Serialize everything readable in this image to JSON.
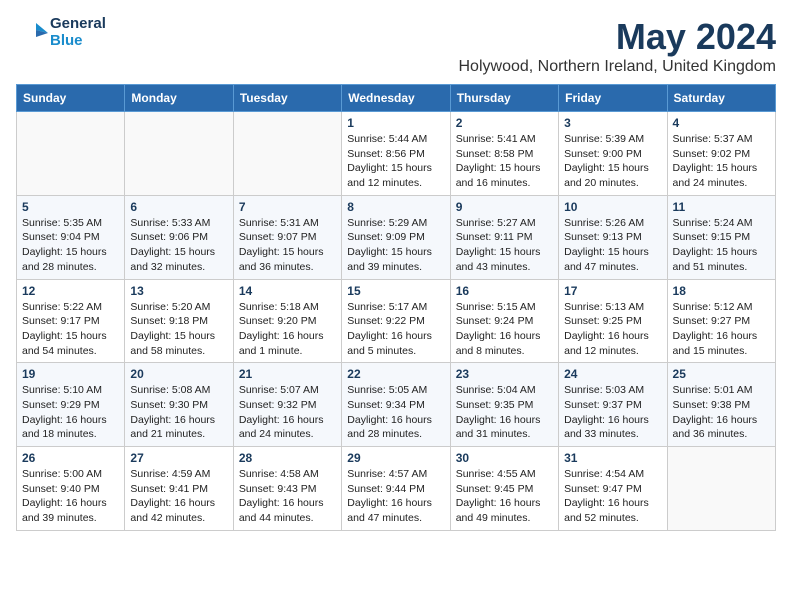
{
  "logo": {
    "line1": "General",
    "line2": "Blue"
  },
  "title": "May 2024",
  "location": "Holywood, Northern Ireland, United Kingdom",
  "weekdays": [
    "Sunday",
    "Monday",
    "Tuesday",
    "Wednesday",
    "Thursday",
    "Friday",
    "Saturday"
  ],
  "weeks": [
    [
      {
        "day": "",
        "info": ""
      },
      {
        "day": "",
        "info": ""
      },
      {
        "day": "",
        "info": ""
      },
      {
        "day": "1",
        "info": "Sunrise: 5:44 AM\nSunset: 8:56 PM\nDaylight: 15 hours\nand 12 minutes."
      },
      {
        "day": "2",
        "info": "Sunrise: 5:41 AM\nSunset: 8:58 PM\nDaylight: 15 hours\nand 16 minutes."
      },
      {
        "day": "3",
        "info": "Sunrise: 5:39 AM\nSunset: 9:00 PM\nDaylight: 15 hours\nand 20 minutes."
      },
      {
        "day": "4",
        "info": "Sunrise: 5:37 AM\nSunset: 9:02 PM\nDaylight: 15 hours\nand 24 minutes."
      }
    ],
    [
      {
        "day": "5",
        "info": "Sunrise: 5:35 AM\nSunset: 9:04 PM\nDaylight: 15 hours\nand 28 minutes."
      },
      {
        "day": "6",
        "info": "Sunrise: 5:33 AM\nSunset: 9:06 PM\nDaylight: 15 hours\nand 32 minutes."
      },
      {
        "day": "7",
        "info": "Sunrise: 5:31 AM\nSunset: 9:07 PM\nDaylight: 15 hours\nand 36 minutes."
      },
      {
        "day": "8",
        "info": "Sunrise: 5:29 AM\nSunset: 9:09 PM\nDaylight: 15 hours\nand 39 minutes."
      },
      {
        "day": "9",
        "info": "Sunrise: 5:27 AM\nSunset: 9:11 PM\nDaylight: 15 hours\nand 43 minutes."
      },
      {
        "day": "10",
        "info": "Sunrise: 5:26 AM\nSunset: 9:13 PM\nDaylight: 15 hours\nand 47 minutes."
      },
      {
        "day": "11",
        "info": "Sunrise: 5:24 AM\nSunset: 9:15 PM\nDaylight: 15 hours\nand 51 minutes."
      }
    ],
    [
      {
        "day": "12",
        "info": "Sunrise: 5:22 AM\nSunset: 9:17 PM\nDaylight: 15 hours\nand 54 minutes."
      },
      {
        "day": "13",
        "info": "Sunrise: 5:20 AM\nSunset: 9:18 PM\nDaylight: 15 hours\nand 58 minutes."
      },
      {
        "day": "14",
        "info": "Sunrise: 5:18 AM\nSunset: 9:20 PM\nDaylight: 16 hours\nand 1 minute."
      },
      {
        "day": "15",
        "info": "Sunrise: 5:17 AM\nSunset: 9:22 PM\nDaylight: 16 hours\nand 5 minutes."
      },
      {
        "day": "16",
        "info": "Sunrise: 5:15 AM\nSunset: 9:24 PM\nDaylight: 16 hours\nand 8 minutes."
      },
      {
        "day": "17",
        "info": "Sunrise: 5:13 AM\nSunset: 9:25 PM\nDaylight: 16 hours\nand 12 minutes."
      },
      {
        "day": "18",
        "info": "Sunrise: 5:12 AM\nSunset: 9:27 PM\nDaylight: 16 hours\nand 15 minutes."
      }
    ],
    [
      {
        "day": "19",
        "info": "Sunrise: 5:10 AM\nSunset: 9:29 PM\nDaylight: 16 hours\nand 18 minutes."
      },
      {
        "day": "20",
        "info": "Sunrise: 5:08 AM\nSunset: 9:30 PM\nDaylight: 16 hours\nand 21 minutes."
      },
      {
        "day": "21",
        "info": "Sunrise: 5:07 AM\nSunset: 9:32 PM\nDaylight: 16 hours\nand 24 minutes."
      },
      {
        "day": "22",
        "info": "Sunrise: 5:05 AM\nSunset: 9:34 PM\nDaylight: 16 hours\nand 28 minutes."
      },
      {
        "day": "23",
        "info": "Sunrise: 5:04 AM\nSunset: 9:35 PM\nDaylight: 16 hours\nand 31 minutes."
      },
      {
        "day": "24",
        "info": "Sunrise: 5:03 AM\nSunset: 9:37 PM\nDaylight: 16 hours\nand 33 minutes."
      },
      {
        "day": "25",
        "info": "Sunrise: 5:01 AM\nSunset: 9:38 PM\nDaylight: 16 hours\nand 36 minutes."
      }
    ],
    [
      {
        "day": "26",
        "info": "Sunrise: 5:00 AM\nSunset: 9:40 PM\nDaylight: 16 hours\nand 39 minutes."
      },
      {
        "day": "27",
        "info": "Sunrise: 4:59 AM\nSunset: 9:41 PM\nDaylight: 16 hours\nand 42 minutes."
      },
      {
        "day": "28",
        "info": "Sunrise: 4:58 AM\nSunset: 9:43 PM\nDaylight: 16 hours\nand 44 minutes."
      },
      {
        "day": "29",
        "info": "Sunrise: 4:57 AM\nSunset: 9:44 PM\nDaylight: 16 hours\nand 47 minutes."
      },
      {
        "day": "30",
        "info": "Sunrise: 4:55 AM\nSunset: 9:45 PM\nDaylight: 16 hours\nand 49 minutes."
      },
      {
        "day": "31",
        "info": "Sunrise: 4:54 AM\nSunset: 9:47 PM\nDaylight: 16 hours\nand 52 minutes."
      },
      {
        "day": "",
        "info": ""
      }
    ]
  ]
}
